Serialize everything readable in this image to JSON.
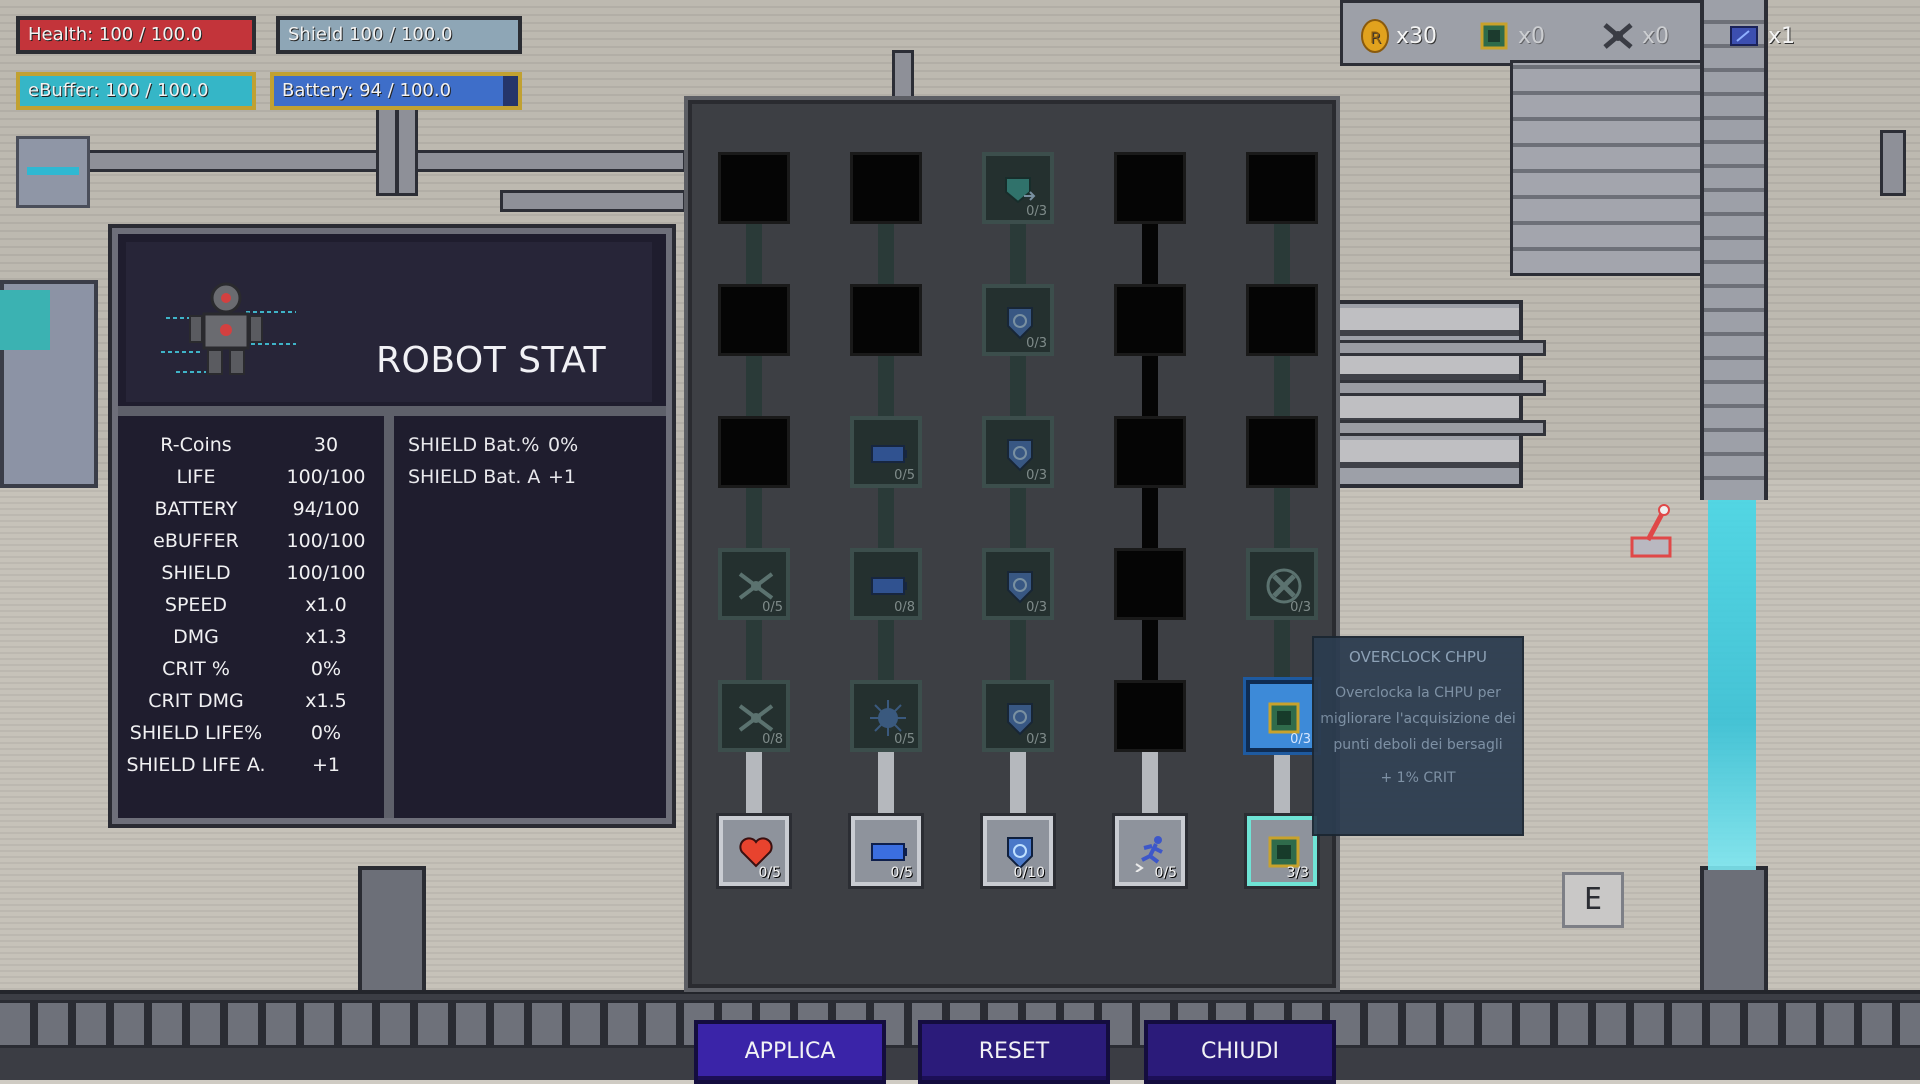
{
  "hud": {
    "health": {
      "label": "Health: 100 / 100.0",
      "fraction": 1.0
    },
    "shield": {
      "label": "Shield 100 / 100.0",
      "fraction": 1.0
    },
    "ebuffer": {
      "label": "eBuffer: 100 / 100.0",
      "fraction": 1.0
    },
    "battery": {
      "label": "Battery: 94 / 100.0",
      "fraction": 0.94
    }
  },
  "inventory": [
    {
      "icon": "coin-icon",
      "count": "x30"
    },
    {
      "icon": "chip-icon",
      "count": "x0"
    },
    {
      "icon": "drone-part-icon",
      "count": "x0"
    },
    {
      "icon": "battery-cell-icon",
      "count": "x1"
    }
  ],
  "robot_stat": {
    "title": "ROBOT STAT",
    "left_rows": [
      {
        "k": "R-Coins",
        "v": "30"
      },
      {
        "k": "LIFE",
        "v": "100/100"
      },
      {
        "k": "BATTERY",
        "v": "94/100"
      },
      {
        "k": "eBUFFER",
        "v": "100/100"
      },
      {
        "k": "SHIELD",
        "v": "100/100"
      },
      {
        "k": "SPEED",
        "v": "x1.0"
      },
      {
        "k": "DMG",
        "v": "x1.3"
      },
      {
        "k": "CRIT %",
        "v": "0%"
      },
      {
        "k": "CRIT DMG",
        "v": "x1.5"
      },
      {
        "k": "SHIELD LIFE%",
        "v": "0%"
      },
      {
        "k": "SHIELD LIFE A.",
        "v": "+1"
      }
    ],
    "right_rows": [
      {
        "k": "SHIELD Bat.%",
        "v": "0%"
      },
      {
        "k": "SHIELD Bat. A",
        "v": "+1"
      }
    ]
  },
  "skill_tree": {
    "columns": [
      {
        "nodes": [
          {
            "state": "locked"
          },
          {
            "state": "locked"
          },
          {
            "state": "locked"
          },
          {
            "state": "avail",
            "icon": "drone-icon",
            "count": "0/5"
          },
          {
            "state": "avail",
            "icon": "drone-icon",
            "count": "0/8"
          }
        ],
        "base": {
          "icon": "heart-icon",
          "count": "0/5"
        }
      },
      {
        "nodes": [
          {
            "state": "locked"
          },
          {
            "state": "locked"
          },
          {
            "state": "avail",
            "icon": "battery-icon",
            "count": "0/5"
          },
          {
            "state": "avail",
            "icon": "battery-icon",
            "count": "0/8"
          },
          {
            "state": "avail",
            "icon": "spark-icon",
            "count": "0/5"
          }
        ],
        "base": {
          "icon": "battery-icon",
          "count": "0/5"
        }
      },
      {
        "nodes": [
          {
            "state": "avail",
            "icon": "shield-swap-icon",
            "count": "0/3"
          },
          {
            "state": "avail",
            "icon": "shield-heart-icon",
            "count": "0/3"
          },
          {
            "state": "avail",
            "icon": "shield-icon",
            "count": "0/3"
          },
          {
            "state": "avail",
            "icon": "shield-icon",
            "count": "0/3"
          },
          {
            "state": "avail",
            "icon": "shield-icon",
            "count": "0/3"
          }
        ],
        "base": {
          "icon": "shield-icon",
          "count": "0/10"
        }
      },
      {
        "nodes": [
          {
            "state": "locked"
          },
          {
            "state": "locked"
          },
          {
            "state": "locked"
          },
          {
            "state": "locked"
          },
          {
            "state": "locked"
          }
        ],
        "base": {
          "icon": "runner-icon",
          "count": "0/5"
        }
      },
      {
        "nodes": [
          {
            "state": "locked"
          },
          {
            "state": "locked"
          },
          {
            "state": "locked"
          },
          {
            "state": "avail",
            "icon": "fan-icon",
            "count": "0/3"
          },
          {
            "state": "sel",
            "icon": "cpu-icon",
            "count": "0/3"
          }
        ],
        "base": {
          "icon": "cpu-icon",
          "count": "3/3",
          "done": true
        }
      }
    ],
    "buttons": {
      "apply": "APPLICA",
      "reset": "RESET",
      "close": "CHIUDI"
    }
  },
  "tooltip": {
    "title": "OVERCLOCK CHPU",
    "desc": "Overclocka la CHPU per migliorare l'acquisizione dei punti deboli dei bersagli",
    "bonus": "+ 1% CRIT"
  },
  "prompt_key": "E",
  "colors": {
    "accent": "#2b1b7a",
    "health": "#c3343a",
    "ebuffer": "#35b6c7",
    "battery": "#3e6ec9"
  }
}
